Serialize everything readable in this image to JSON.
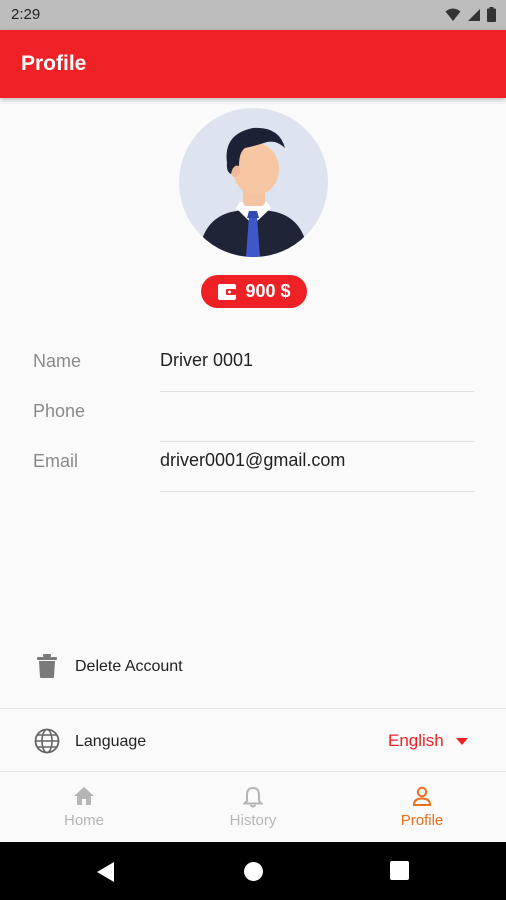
{
  "status_bar": {
    "time": "2:29",
    "icons": [
      "wifi-icon",
      "signal-icon",
      "battery-icon"
    ]
  },
  "app_bar": {
    "title": "Profile",
    "color": "#ee2226"
  },
  "profile": {
    "avatar_icon": "driver-avatar",
    "balance": "900 $",
    "balance_icon": "wallet-icon"
  },
  "fields": [
    {
      "label": "Name",
      "value": "Driver 0001"
    },
    {
      "label": "Phone",
      "value": ""
    },
    {
      "label": "Email",
      "value": "driver0001@gmail.com"
    }
  ],
  "actions": {
    "delete_account": "Delete Account",
    "language_label": "Language",
    "language_value": "English"
  },
  "bottom_nav": {
    "items": [
      {
        "label": "Home",
        "icon": "home-icon",
        "active": false
      },
      {
        "label": "History",
        "icon": "bell-icon",
        "active": false
      },
      {
        "label": "Profile",
        "icon": "person-icon",
        "active": true
      }
    ],
    "active_color": "#e8701f"
  },
  "system_nav": [
    "back-icon",
    "home-circle-icon",
    "recents-icon"
  ]
}
